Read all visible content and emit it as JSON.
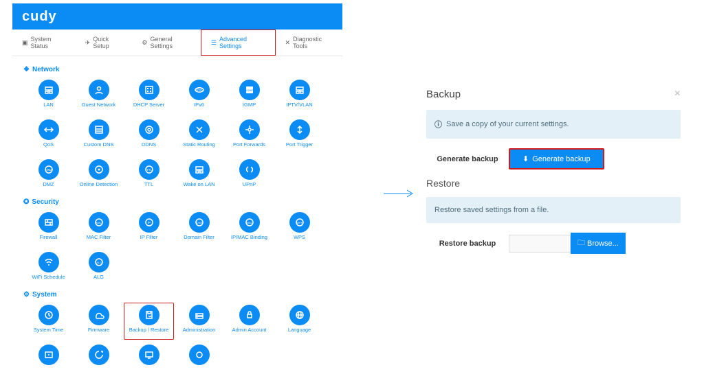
{
  "brand": "cudy",
  "tabs": [
    {
      "label": "System Status"
    },
    {
      "label": "Quick Setup"
    },
    {
      "label": "General Settings"
    },
    {
      "label": "Advanced Settings",
      "active": true
    },
    {
      "label": "Diagnostic Tools"
    }
  ],
  "sections": {
    "network": {
      "title": "Network",
      "items": [
        {
          "label": "LAN"
        },
        {
          "label": "Guest Network"
        },
        {
          "label": "DHCP Server"
        },
        {
          "label": "IPv6"
        },
        {
          "label": "IGMP"
        },
        {
          "label": "IPTV/VLAN"
        },
        {
          "label": "QoS"
        },
        {
          "label": "Custom DNS"
        },
        {
          "label": "DDNS"
        },
        {
          "label": "Static Routing"
        },
        {
          "label": "Port Forwards"
        },
        {
          "label": "Port Trigger"
        },
        {
          "label": "DMZ"
        },
        {
          "label": "Online Detection"
        },
        {
          "label": "TTL"
        },
        {
          "label": "Wake on LAN"
        },
        {
          "label": "UPnP"
        }
      ]
    },
    "security": {
      "title": "Security",
      "items": [
        {
          "label": "Firewall"
        },
        {
          "label": "MAC Filter"
        },
        {
          "label": "IP Filter"
        },
        {
          "label": "Domain Filter"
        },
        {
          "label": "IP/MAC Binding"
        },
        {
          "label": "WPS"
        },
        {
          "label": "WiFi Schedule"
        },
        {
          "label": "ALG"
        }
      ]
    },
    "system": {
      "title": "System",
      "items": [
        {
          "label": "System Time"
        },
        {
          "label": "Firmware"
        },
        {
          "label": "Backup / Restore",
          "highlight": true
        },
        {
          "label": "Administration"
        },
        {
          "label": "Admin Account"
        },
        {
          "label": "Language"
        },
        {
          "label": ""
        },
        {
          "label": ""
        },
        {
          "label": ""
        },
        {
          "label": ""
        }
      ]
    }
  },
  "dialog": {
    "title": "Backup",
    "info1": "Save a copy of your current settings.",
    "gen_label": "Generate backup",
    "gen_btn": "Generate backup",
    "restore_title": "Restore",
    "info2": "Restore saved settings from a file.",
    "restore_label": "Restore backup",
    "browse_btn": "Browse..."
  }
}
